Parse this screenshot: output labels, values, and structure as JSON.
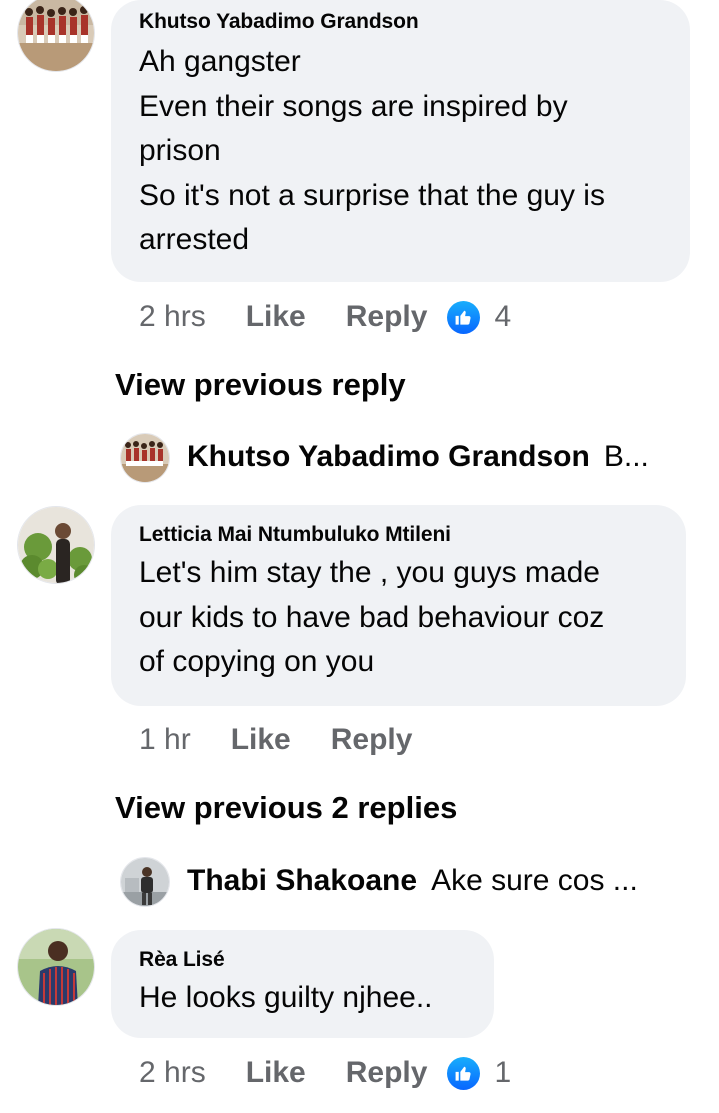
{
  "comments": [
    {
      "author": "Khutso Yabadimo Grandson",
      "lines": [
        "Ah gangster",
        "Even their songs are  inspired by",
        "prison",
        "So it's not a surprise that the guy is",
        "arrested"
      ],
      "time": "2 hrs",
      "like_label": "Like",
      "reply_label": "Reply",
      "reaction_icon": "like-icon",
      "reaction_count": "4",
      "view_prev": "View previous reply",
      "reply_preview": {
        "author": "Khutso Yabadimo Grandson",
        "snippet": "B..."
      }
    },
    {
      "author": "Letticia Mai Ntumbuluko Mtileni",
      "lines": [
        "Let's him stay the , you guys made",
        "our kids to have bad behaviour coz",
        "of copying on you"
      ],
      "time": "1 hr",
      "like_label": "Like",
      "reply_label": "Reply",
      "view_prev": "View previous 2 replies",
      "reply_preview": {
        "author": "Thabi Shakoane",
        "snippet": "Ake sure cos ..."
      }
    },
    {
      "author": "Rèa Lisé",
      "lines": [
        "He looks guilty njhee.."
      ],
      "time": "2 hrs",
      "like_label": "Like",
      "reply_label": "Reply",
      "reaction_icon": "like-icon",
      "reaction_count": "1"
    }
  ],
  "colors": {
    "bubble": "#f0f2f5",
    "secondary_text": "#65676b",
    "like_blue": "#0866ff"
  }
}
